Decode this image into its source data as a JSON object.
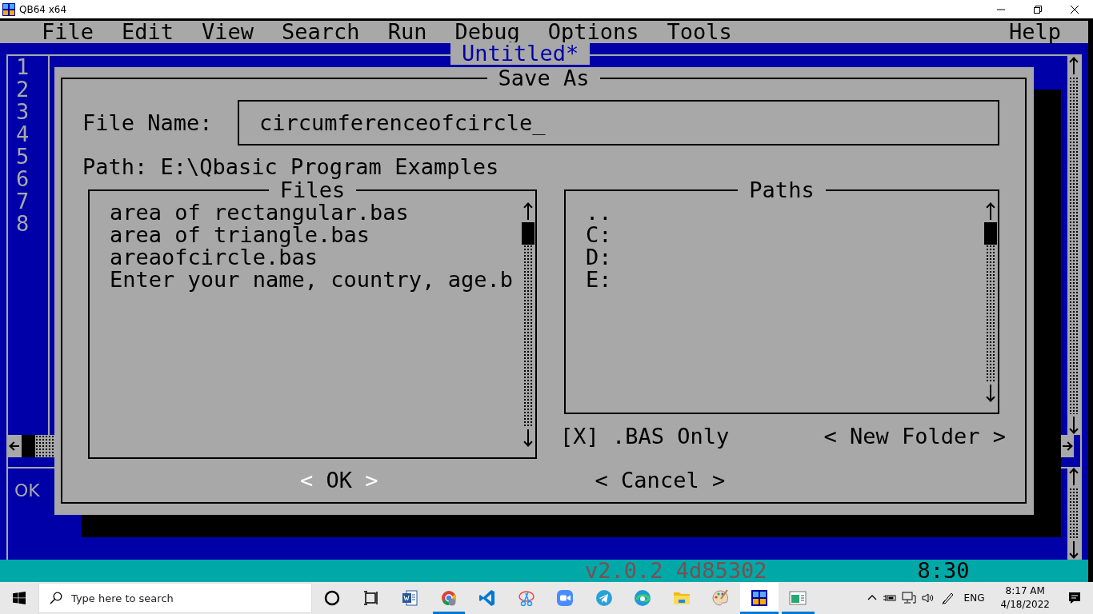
{
  "window": {
    "title": "QB64 x64"
  },
  "menu": [
    {
      "label": "File"
    },
    {
      "label": "Edit"
    },
    {
      "label": "View"
    },
    {
      "label": "Search"
    },
    {
      "label": "Run"
    },
    {
      "label": "Debug"
    },
    {
      "label": "Options"
    },
    {
      "label": "Tools"
    },
    {
      "label": "Help"
    }
  ],
  "editor": {
    "title": "Untitled*",
    "line_numbers": [
      "1",
      "2",
      "3",
      "4",
      "5",
      "6",
      "7",
      "8"
    ],
    "immediate_text": "OK"
  },
  "dialog": {
    "title": "Save As",
    "file_name_label": "File Name:",
    "file_name_value": "circumferenceofcircle_",
    "path": "Path: E:\\Qbasic Program Examples",
    "files": {
      "title": "Files",
      "items": [
        "area of rectangular.bas",
        "area of triangle.bas",
        "areaofcircle.bas",
        "Enter your name, country, age.b"
      ]
    },
    "paths": {
      "title": "Paths",
      "items": [
        "..",
        "C:",
        "D:",
        "E:"
      ]
    },
    "bas_only": {
      "open": "[",
      "mark": "X",
      "close": "]",
      "label": ".BAS Only",
      "checked": true
    },
    "new_folder": {
      "open": "<",
      "label": "New Folder",
      "close": ">",
      "focused": false
    },
    "buttons": [
      {
        "open": "<",
        "label": "OK",
        "close": ">",
        "focused": true
      },
      {
        "open": "<",
        "label": "Cancel",
        "close": ">",
        "focused": false
      }
    ]
  },
  "status_bar": {
    "version": "v2.0.2 4d85302",
    "position": "8:30"
  },
  "taskbar": {
    "search_placeholder": "Type here to search",
    "apps": [
      {
        "kind": "cortana",
        "running": false,
        "active": false
      },
      {
        "kind": "task-view",
        "running": false,
        "active": false
      },
      {
        "kind": "word",
        "running": false,
        "active": false
      },
      {
        "kind": "chrome",
        "running": true,
        "active": false
      },
      {
        "kind": "vscode",
        "running": false,
        "active": false
      },
      {
        "kind": "snip",
        "running": false,
        "active": false
      },
      {
        "kind": "zoom",
        "running": false,
        "active": false
      },
      {
        "kind": "telegram",
        "running": false,
        "active": false
      },
      {
        "kind": "edge",
        "running": false,
        "active": false
      },
      {
        "kind": "folder",
        "running": false,
        "active": false
      },
      {
        "kind": "paint",
        "running": false,
        "active": false
      },
      {
        "kind": "qb64",
        "running": true,
        "active": true
      },
      {
        "kind": "monitor",
        "running": true,
        "active": false
      }
    ],
    "language": "ENG",
    "time": "8:17 AM",
    "date": "4/18/2022"
  }
}
